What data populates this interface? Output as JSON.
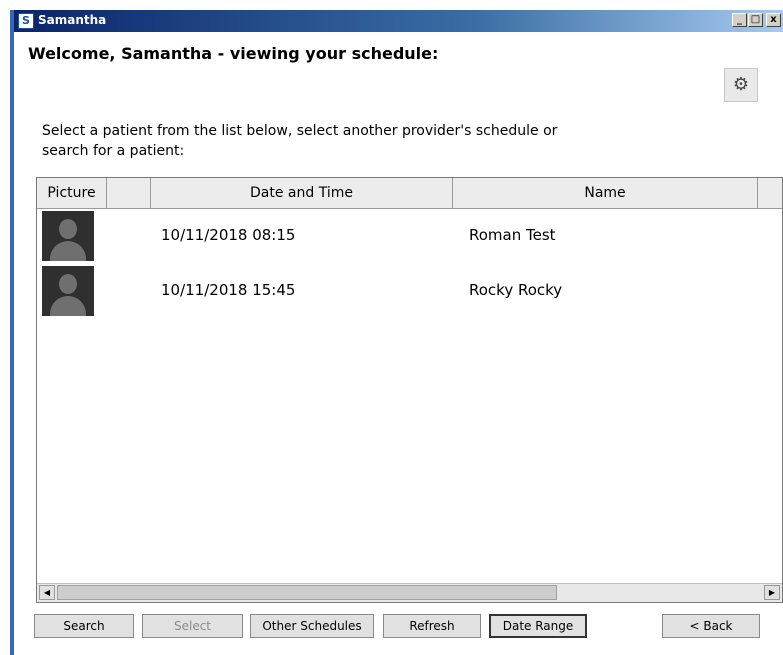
{
  "window": {
    "title": "Samantha",
    "app_icon_letter": "S",
    "controls": {
      "minimize": "_",
      "maximize": "□",
      "close": "x"
    }
  },
  "header": {
    "welcome": "Welcome, Samantha - viewing your schedule:",
    "settings_icon": "gear-icon"
  },
  "instructions": "Select a patient from the list below, select another provider's schedule or search for a patient:",
  "table": {
    "columns": {
      "picture": "Picture",
      "blank": "",
      "date_time": "Date and Time",
      "name": "Name"
    },
    "rows": [
      {
        "date_time": "10/11/2018 08:15",
        "name": "Roman Test"
      },
      {
        "date_time": "10/11/2018 15:45",
        "name": "Rocky Rocky"
      }
    ]
  },
  "buttons": {
    "search": "Search",
    "select": "Select",
    "other_schedules": "Other Schedules",
    "refresh": "Refresh",
    "date_range": "Date Range",
    "back": "< Back"
  },
  "colors": {
    "titlebar_start": "#0a246a",
    "titlebar_end": "#a6caf0",
    "window_border": "#3a66b8"
  }
}
